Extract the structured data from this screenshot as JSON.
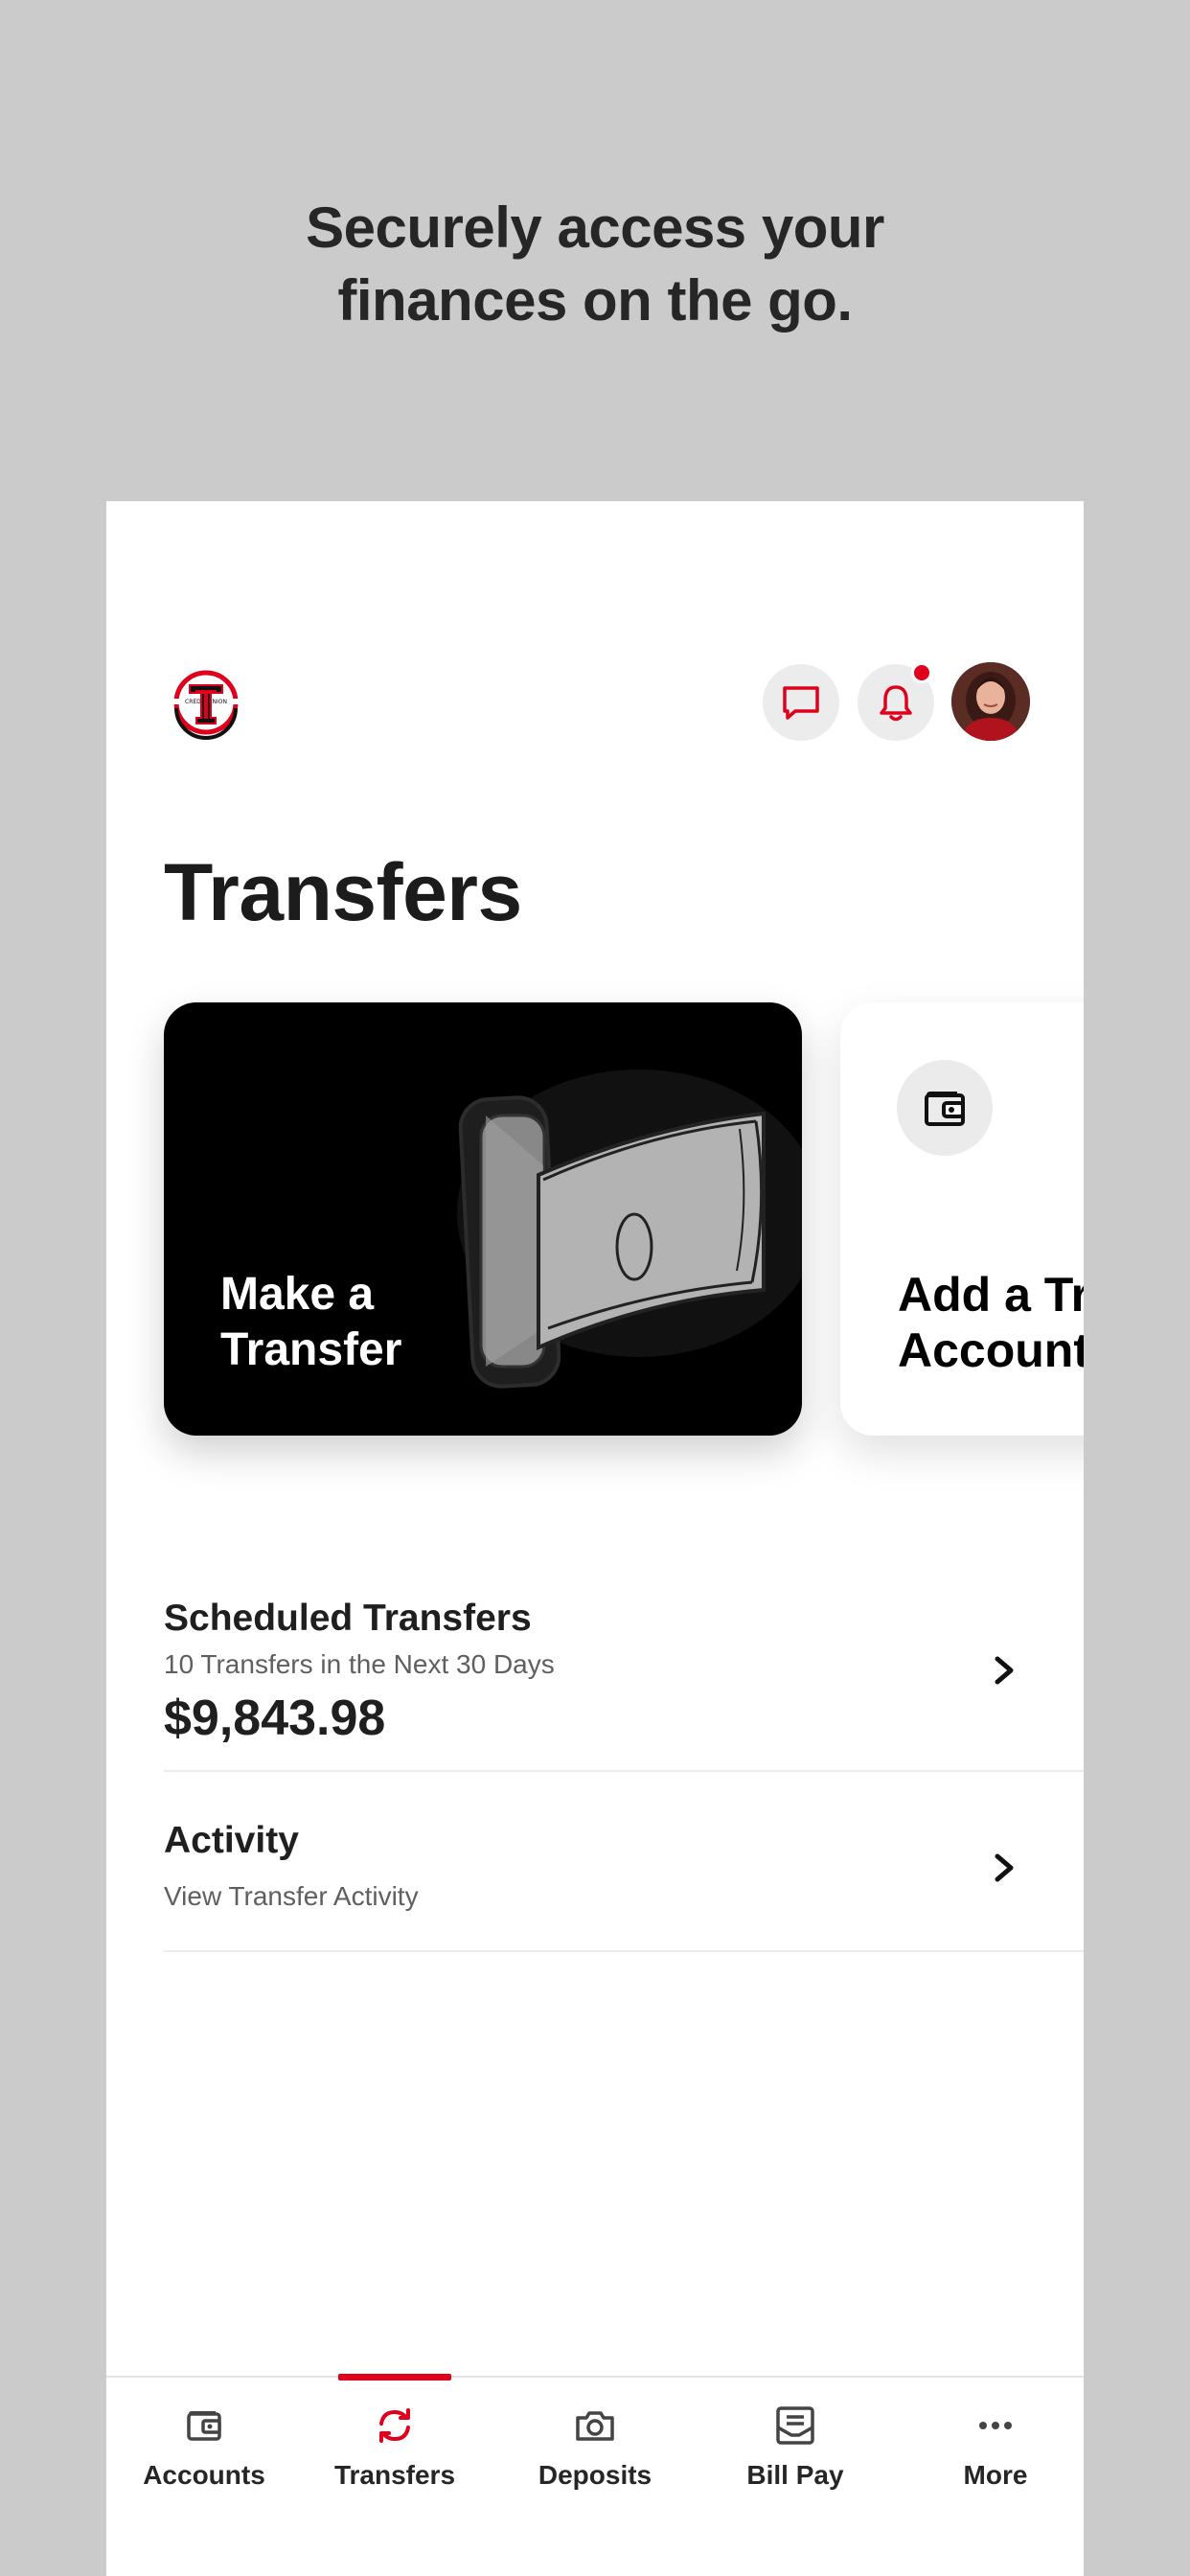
{
  "headline": {
    "line1": "Securely access your",
    "line2": "finances on the go."
  },
  "header": {
    "logo_icon": "credit-union-double-t-logo",
    "chat_icon": "chat-bubble-icon",
    "bell_icon": "bell-icon",
    "has_notification": true,
    "avatar": "user-avatar"
  },
  "page": {
    "title": "Transfers"
  },
  "cards": {
    "make_transfer": {
      "label": "Make a Transfer",
      "line1": "Make a",
      "line2": "Transfer",
      "illustration": "phone-with-money-bill"
    },
    "add_account": {
      "label": "Add a Transfer Account",
      "line1": "Add a Tr",
      "line2": "Account",
      "icon": "wallet-icon"
    }
  },
  "list": {
    "scheduled": {
      "title": "Scheduled Transfers",
      "subtitle": "10 Transfers in the Next 30 Days",
      "amount": "$9,843.98"
    },
    "activity": {
      "title": "Activity",
      "subtitle": "View Transfer Activity"
    }
  },
  "nav": {
    "active": "Transfers",
    "items": [
      {
        "label": "Accounts",
        "icon": "wallet-icon"
      },
      {
        "label": "Transfers",
        "icon": "transfer-arrows-icon"
      },
      {
        "label": "Deposits",
        "icon": "camera-icon"
      },
      {
        "label": "Bill Pay",
        "icon": "bill-inbox-icon"
      },
      {
        "label": "More",
        "icon": "more-dots-icon"
      }
    ]
  },
  "colors": {
    "accent": "#e0001b",
    "background": "#cbcbcb",
    "card_dark": "#000000",
    "icon_circle": "#ececec"
  }
}
